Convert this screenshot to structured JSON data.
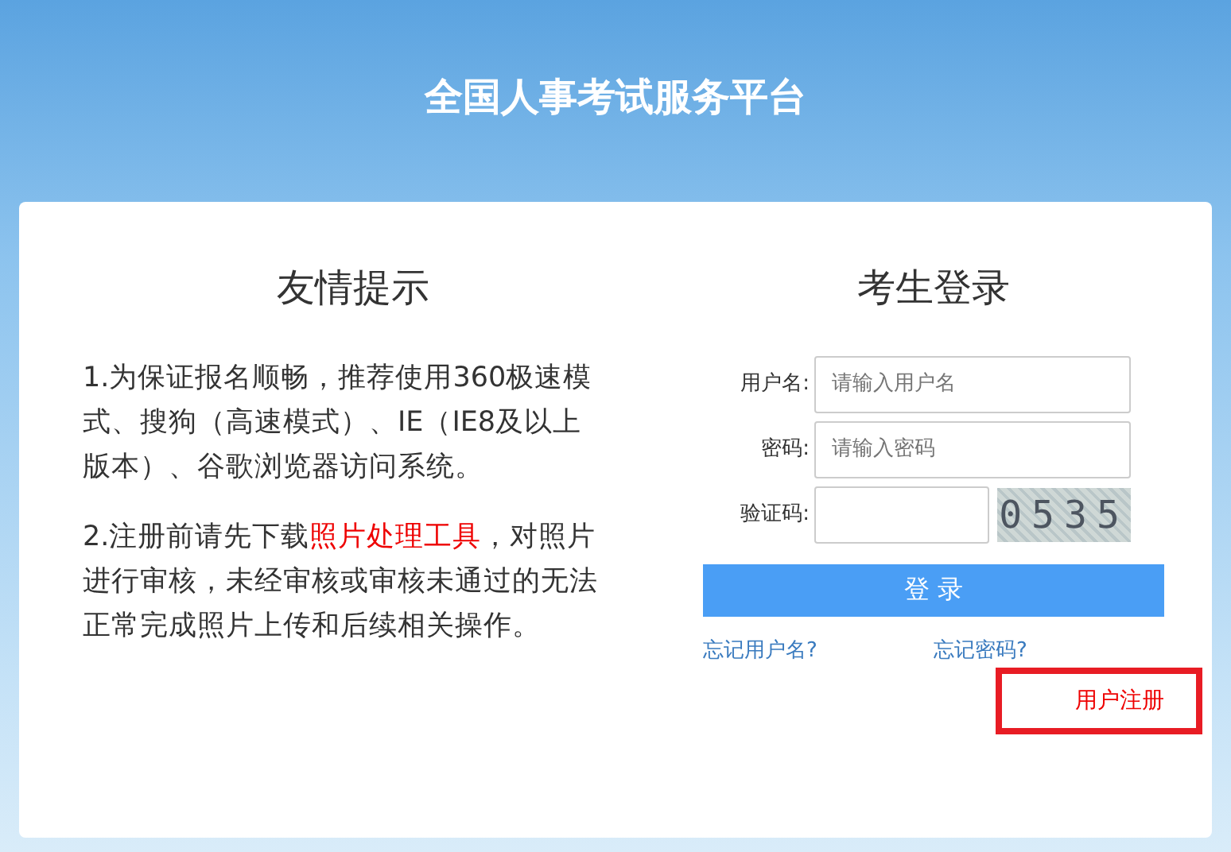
{
  "header": {
    "title": "全国人事考试服务平台"
  },
  "notice": {
    "heading": "友情提示",
    "paragraphs": [
      {
        "kind": "plain",
        "text": "1.为保证报名顺畅，推荐使用360极速模式、搜狗（高速模式）、IE（IE8及以上版本）、谷歌浏览器访问系统。"
      },
      {
        "kind": "with_link",
        "before": "2.注册前请先下载",
        "link": "照片处理工具",
        "after": "，对照片进行审核，未经审核或审核未通过的无法正常完成照片上传和后续相关操作。"
      }
    ]
  },
  "login": {
    "heading": "考生登录",
    "fields": [
      {
        "label": "用户名:",
        "placeholder": "请输入用户名",
        "kind": "text"
      },
      {
        "label": "密码:",
        "placeholder": "请输入密码",
        "kind": "password"
      },
      {
        "label": "验证码:",
        "kind": "captcha",
        "captcha": "0535"
      }
    ],
    "button": "登 录",
    "links": [
      "忘记用户名?",
      "忘记密码?"
    ],
    "register": "用户注册"
  }
}
